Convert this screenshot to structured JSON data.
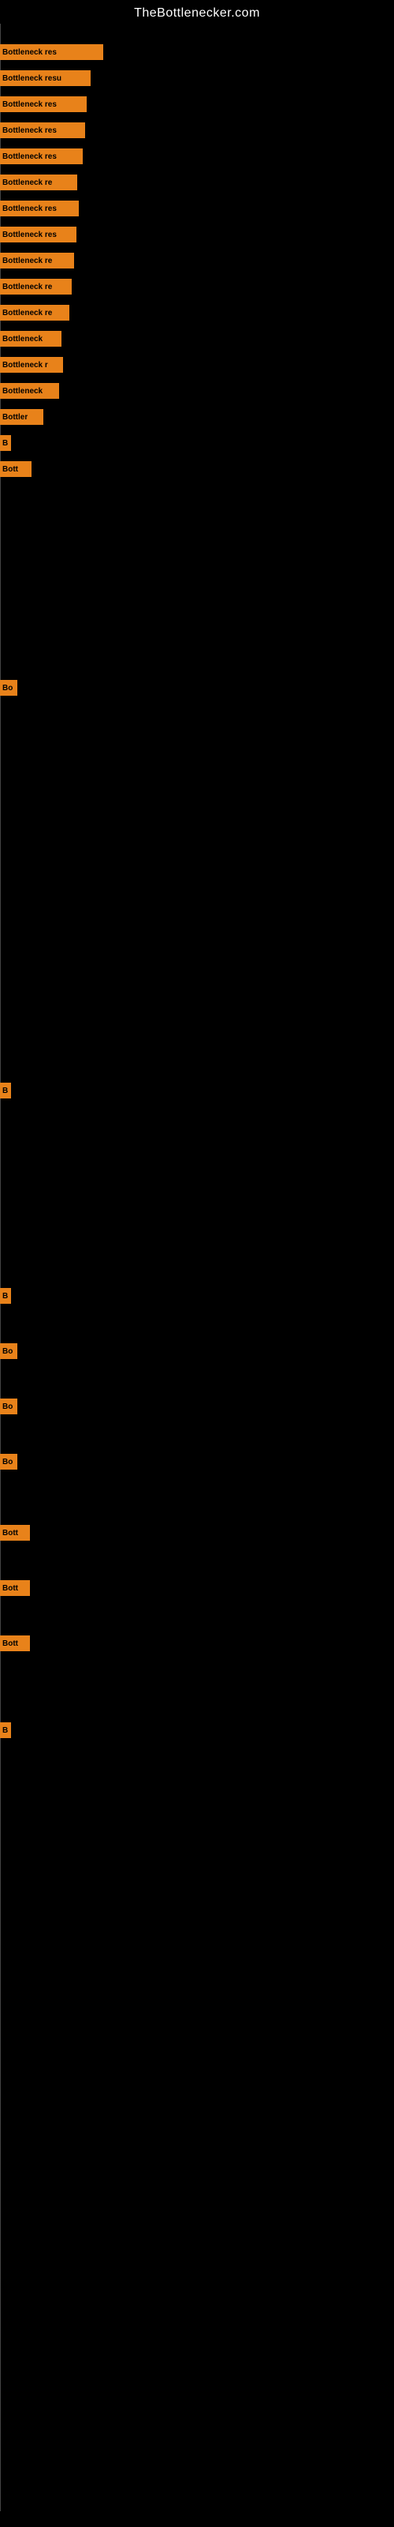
{
  "site": {
    "title": "TheBottlenecker.com"
  },
  "bars": [
    {
      "label": "Bottleneck res",
      "width": 131,
      "text": "Bottleneck res"
    },
    {
      "label": "Bottleneck res",
      "width": 115,
      "text": "Bottleneck resu"
    },
    {
      "label": "Bottleneck res",
      "width": 110,
      "text": "Bottleneck res"
    },
    {
      "label": "Bottleneck res",
      "width": 108,
      "text": "Bottleneck res"
    },
    {
      "label": "Bottleneck res",
      "width": 105,
      "text": "Bottleneck res"
    },
    {
      "label": "Bottleneck re",
      "width": 98,
      "text": "Bottleneck re"
    },
    {
      "label": "Bottleneck res",
      "width": 100,
      "text": "Bottleneck res"
    },
    {
      "label": "Bottleneck res",
      "width": 97,
      "text": "Bottleneck res"
    },
    {
      "label": "Bottleneck re",
      "width": 94,
      "text": "Bottleneck re"
    },
    {
      "label": "Bottleneck re",
      "width": 91,
      "text": "Bottleneck re"
    },
    {
      "label": "Bottleneck re",
      "width": 88,
      "text": "Bottleneck re"
    },
    {
      "label": "Bottleneck",
      "width": 78,
      "text": "Bottleneck"
    },
    {
      "label": "Bottleneck r",
      "width": 80,
      "text": "Bottleneck r"
    },
    {
      "label": "Bottleneck",
      "width": 75,
      "text": "Bottleneck"
    },
    {
      "label": "Bottler",
      "width": 55,
      "text": "Bottler"
    },
    {
      "label": "B",
      "width": 14,
      "text": "B"
    },
    {
      "label": "Bott",
      "width": 40,
      "text": "Bott"
    },
    {
      "label": "",
      "width": 0,
      "text": ""
    },
    {
      "label": "",
      "width": 0,
      "text": ""
    },
    {
      "label": "",
      "width": 0,
      "text": ""
    },
    {
      "label": "Bo",
      "width": 22,
      "text": "Bo"
    },
    {
      "label": "",
      "width": 0,
      "text": ""
    },
    {
      "label": "",
      "width": 0,
      "text": ""
    },
    {
      "label": "",
      "width": 0,
      "text": ""
    },
    {
      "label": "",
      "width": 0,
      "text": ""
    },
    {
      "label": "",
      "width": 0,
      "text": ""
    },
    {
      "label": "",
      "width": 0,
      "text": ""
    },
    {
      "label": "B",
      "width": 14,
      "text": "B"
    },
    {
      "label": "",
      "width": 0,
      "text": ""
    },
    {
      "label": "",
      "width": 0,
      "text": ""
    },
    {
      "label": "B",
      "width": 14,
      "text": "B"
    },
    {
      "label": "Bo",
      "width": 22,
      "text": "Bo"
    },
    {
      "label": "Bo",
      "width": 22,
      "text": "Bo"
    },
    {
      "label": "Bo",
      "width": 22,
      "text": "Bo"
    },
    {
      "label": "Bott",
      "width": 38,
      "text": "Bott"
    },
    {
      "label": "Bott",
      "width": 38,
      "text": "Bott"
    },
    {
      "label": "Bott",
      "width": 38,
      "text": "Bott"
    },
    {
      "label": "B",
      "width": 14,
      "text": "B"
    }
  ],
  "yPositions": [
    25,
    58,
    91,
    124,
    157,
    190,
    223,
    256,
    289,
    322,
    355,
    388,
    421,
    454,
    487,
    520,
    553,
    640,
    700,
    760,
    830,
    920,
    980,
    1040,
    1100,
    1160,
    1220,
    1340,
    1420,
    1500,
    1600,
    1670,
    1740,
    1810,
    1900,
    1970,
    2040,
    2150
  ]
}
